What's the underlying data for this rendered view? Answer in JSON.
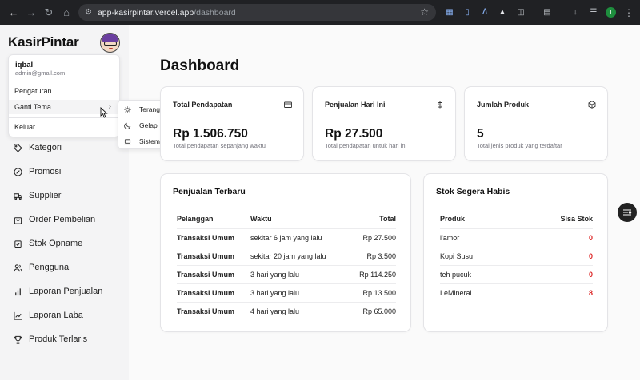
{
  "browser": {
    "url_host": "app-kasirpintar.vercel.app",
    "url_path": "/dashboard",
    "profile_initial": "I"
  },
  "sidebar": {
    "brand": "KasirPintar",
    "items": [
      {
        "label": "Kategori",
        "icon": "tag-icon"
      },
      {
        "label": "Promosi",
        "icon": "badge-percent-icon"
      },
      {
        "label": "Supplier",
        "icon": "truck-icon"
      },
      {
        "label": "Order Pembelian",
        "icon": "shopping-bag-icon"
      },
      {
        "label": "Stok Opname",
        "icon": "clipboard-check-icon"
      },
      {
        "label": "Pengguna",
        "icon": "users-icon"
      },
      {
        "label": "Laporan Penjualan",
        "icon": "bar-chart-icon"
      },
      {
        "label": "Laporan Laba",
        "icon": "line-chart-icon"
      },
      {
        "label": "Produk Terlaris",
        "icon": "trophy-icon"
      }
    ]
  },
  "user_menu": {
    "name": "iqbal",
    "email": "admin@gmail.com",
    "settings": "Pengaturan",
    "theme": "Ganti Tema",
    "logout": "Keluar",
    "theme_options": {
      "light": "Terang",
      "dark": "Gelap",
      "system": "Sistem"
    }
  },
  "main": {
    "title": "Dashboard",
    "stats": [
      {
        "title": "Total Pendapatan",
        "value": "Rp 1.506.750",
        "desc": "Total pendapatan sepanjang waktu",
        "icon": "credit-card-icon"
      },
      {
        "title": "Penjualan Hari Ini",
        "value": "Rp 27.500",
        "desc": "Total pendapatan untuk hari ini",
        "icon": "dollar-sign-icon"
      },
      {
        "title": "Jumlah Produk",
        "value": "5",
        "desc": "Total jenis produk yang terdaftar",
        "icon": "package-icon"
      }
    ],
    "recent_sales": {
      "title": "Penjualan Terbaru",
      "headers": {
        "customer": "Pelanggan",
        "time": "Waktu",
        "total": "Total"
      },
      "rows": [
        {
          "customer": "Transaksi Umum",
          "time": "sekitar 6 jam yang lalu",
          "total": "Rp 27.500"
        },
        {
          "customer": "Transaksi Umum",
          "time": "sekitar 20 jam yang lalu",
          "total": "Rp 3.500"
        },
        {
          "customer": "Transaksi Umum",
          "time": "3 hari yang lalu",
          "total": "Rp 114.250"
        },
        {
          "customer": "Transaksi Umum",
          "time": "3 hari yang lalu",
          "total": "Rp 13.500"
        },
        {
          "customer": "Transaksi Umum",
          "time": "4 hari yang lalu",
          "total": "Rp 65.000"
        }
      ]
    },
    "low_stock": {
      "title": "Stok Segera Habis",
      "headers": {
        "product": "Produk",
        "stock": "Sisa Stok"
      },
      "rows": [
        {
          "product": "l'amor",
          "stock": "0"
        },
        {
          "product": "Kopi Susu",
          "stock": "0"
        },
        {
          "product": "teh pucuk",
          "stock": "0"
        },
        {
          "product": "LeMineral",
          "stock": "8"
        }
      ]
    }
  },
  "colors": {
    "accent_red": "#dc2626",
    "muted": "#71717a",
    "border": "#e4e4e7"
  }
}
